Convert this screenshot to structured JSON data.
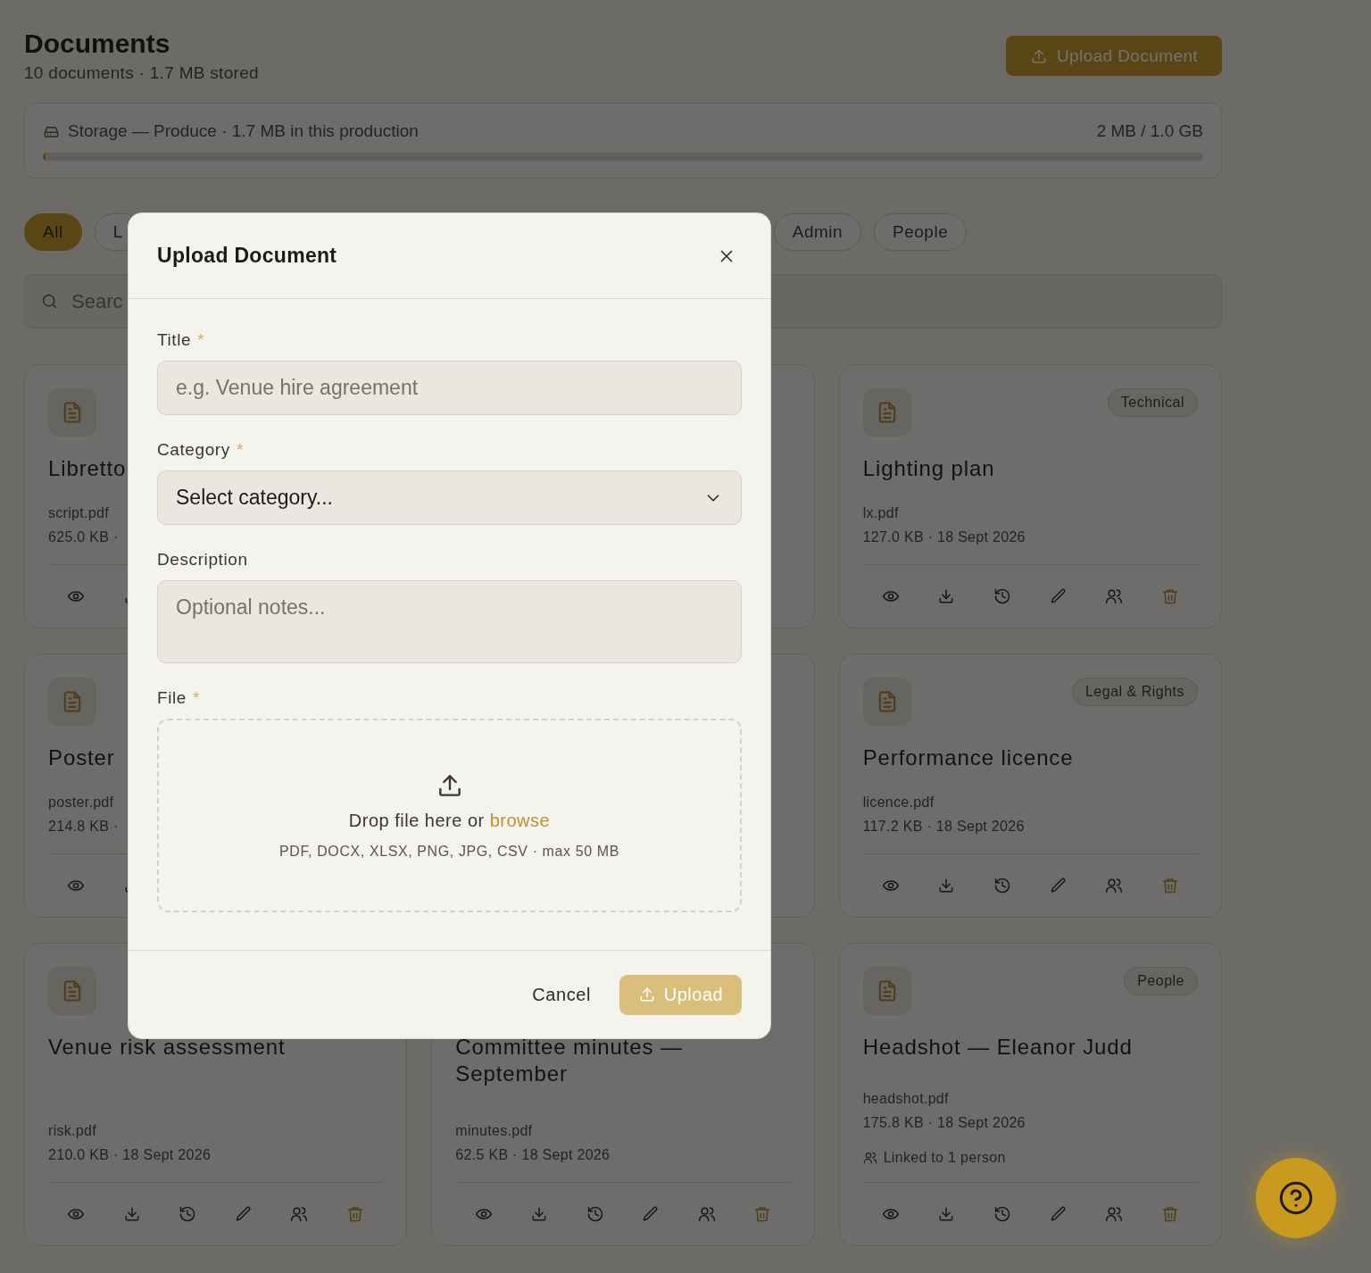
{
  "header": {
    "title": "Documents",
    "subtitle": "10 documents · 1.7 MB stored",
    "upload_button": "Upload Document"
  },
  "storage": {
    "label": "Storage — Produce · 1.7 MB in this production",
    "usage": "2 MB / 1.0 GB",
    "level": 0.002
  },
  "filters": [
    {
      "label": "All",
      "selected": true
    },
    {
      "label": "L",
      "selected": false
    },
    {
      "label": "Admin",
      "selected": false
    },
    {
      "label": "People",
      "selected": false
    }
  ],
  "search": {
    "placeholder": "Searc"
  },
  "documents": [
    {
      "kind": "clipped",
      "title": "Libretto",
      "file": "script.pdf",
      "meta": "625.0 KB ·"
    },
    {
      "kind": "covered"
    },
    {
      "kind": "card",
      "tag": "Technical",
      "title": "Lighting plan",
      "file": "lx.pdf",
      "meta": "127.0 KB · 18 Sept 2026"
    },
    {
      "kind": "clipped",
      "title": "Poster",
      "file": "poster.pdf",
      "meta": "214.8 KB ·"
    },
    {
      "kind": "covered"
    },
    {
      "kind": "card",
      "tag": "Legal & Rights",
      "title": "Performance licence",
      "file": "licence.pdf",
      "meta": "117.2 KB · 18 Sept 2026"
    },
    {
      "kind": "card",
      "title": "Venue risk assessment",
      "file": "risk.pdf",
      "meta": "210.0 KB · 18 Sept 2026"
    },
    {
      "kind": "card",
      "title": "Committee minutes — September",
      "file": "minutes.pdf",
      "meta": "62.5 KB · 18 Sept 2026"
    },
    {
      "kind": "card",
      "tag": "People",
      "title": "Headshot — Eleanor Judd",
      "file": "headshot.pdf",
      "meta": "175.8 KB · 18 Sept 2026",
      "linked": "Linked to 1 person"
    }
  ],
  "modal": {
    "title": "Upload Document",
    "fields": [
      {
        "kind": "text",
        "label": "Title",
        "required_mark": "*",
        "placeholder": "e.g. Venue hire agreement"
      },
      {
        "kind": "select",
        "label": "Category",
        "required_mark": "*",
        "value": "Select category..."
      },
      {
        "kind": "textarea",
        "label": "Description",
        "placeholder": "Optional notes..."
      },
      {
        "kind": "file",
        "label": "File",
        "required_mark": "*",
        "prompt": "Drop file here or",
        "link": "browse",
        "hint": "PDF, DOCX, XLSX, PNG, JPG, CSV · max 50 MB"
      }
    ],
    "cancel": "Cancel",
    "submit": {
      "label": "Upload",
      "disabled": true
    }
  }
}
